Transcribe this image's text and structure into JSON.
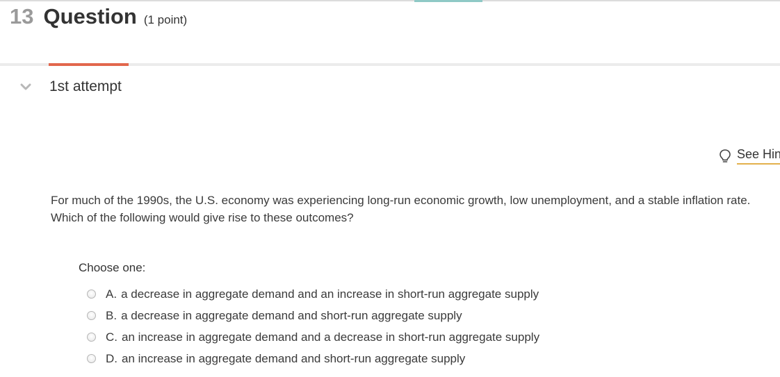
{
  "header": {
    "number": "13",
    "title": "Question",
    "points": "(1 point)"
  },
  "attempt": {
    "label": "1st attempt"
  },
  "hint": {
    "label": "See Hint"
  },
  "question": {
    "text": "For much of the 1990s, the U.S. economy was experiencing long-run economic growth, low unemployment, and a stable inflation rate. Which of the following would give rise to these outcomes?"
  },
  "choices": {
    "prompt": "Choose one:",
    "options": [
      {
        "letter": "A.",
        "text": "a decrease in aggregate demand and an increase in short-run aggregate supply"
      },
      {
        "letter": "B.",
        "text": "a decrease in aggregate demand and short-run aggregate supply"
      },
      {
        "letter": "C.",
        "text": "an increase in aggregate demand and a decrease in short-run aggregate supply"
      },
      {
        "letter": "D.",
        "text": "an increase in aggregate demand and short-run aggregate supply"
      }
    ]
  },
  "colors": {
    "tab_accent": "#e2674d",
    "top_accent": "#8fc9c6",
    "hint_underline": "#e3b04b"
  },
  "icons": [
    "chevron-down-icon",
    "lightbulb-icon",
    "radio-button-icon"
  ]
}
